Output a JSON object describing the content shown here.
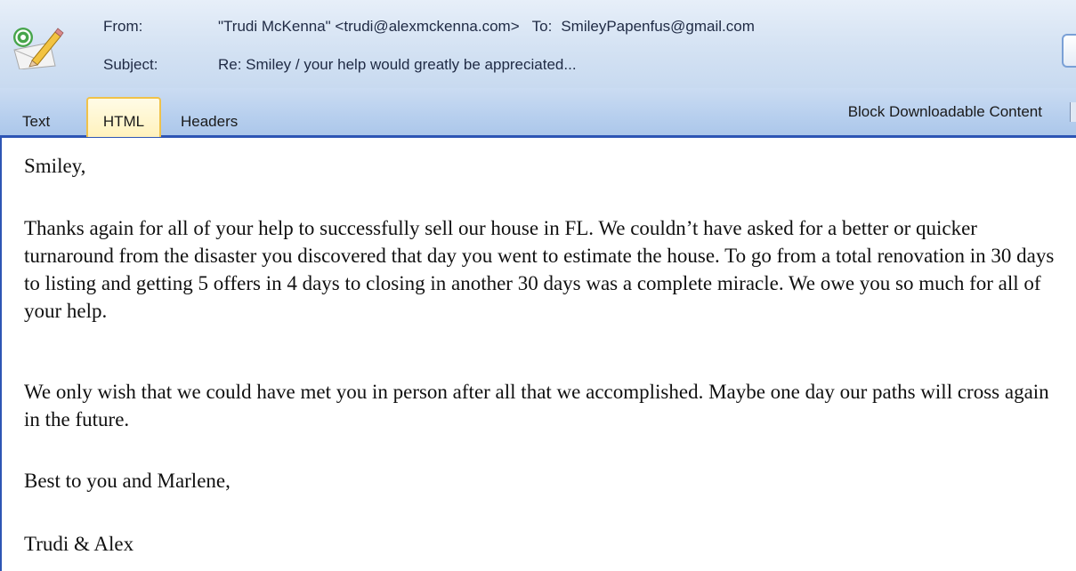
{
  "header": {
    "from_label": "From:",
    "from_value": "\"Trudi McKenna\" <trudi@alexmckenna.com>",
    "to_label": "To:",
    "to_value": "SmileyPapenfus@gmail.com",
    "subject_label": "Subject:",
    "subject_value": "Re: Smiley / your help would greatly be appreciated...",
    "icon": "email-edit-icon"
  },
  "tabs": [
    {
      "label": "Text",
      "selected": false
    },
    {
      "label": "HTML",
      "selected": true
    },
    {
      "label": "Headers",
      "selected": false
    }
  ],
  "toolbar": {
    "block_content_label": "Block Downloadable Content"
  },
  "message": {
    "greeting": "Smiley,",
    "paragraphs": [
      "Thanks again for all of your help to successfully sell our house in FL.  We couldn’t have asked for a better or quicker turnaround from the disaster you discovered that day you went to estimate the house.  To go from a total renovation in 30 days to listing and getting 5 offers in 4 days to closing in another 30 days was a complete miracle.  We owe you so much for all of your help.",
      "We only wish that we could have met you in person after all that we accomplished.  Maybe one day our paths will cross again in the future."
    ],
    "closing": "Best to you and Marlene,",
    "signature": "Trudi & Alex"
  },
  "colors": {
    "header_bg": "#d4e2f3",
    "tabstrip_bg": "#b7cfee",
    "accent_border": "#2d55b4",
    "selected_tab_bg": "#fff2bd",
    "selected_tab_border": "#f0c24a"
  }
}
